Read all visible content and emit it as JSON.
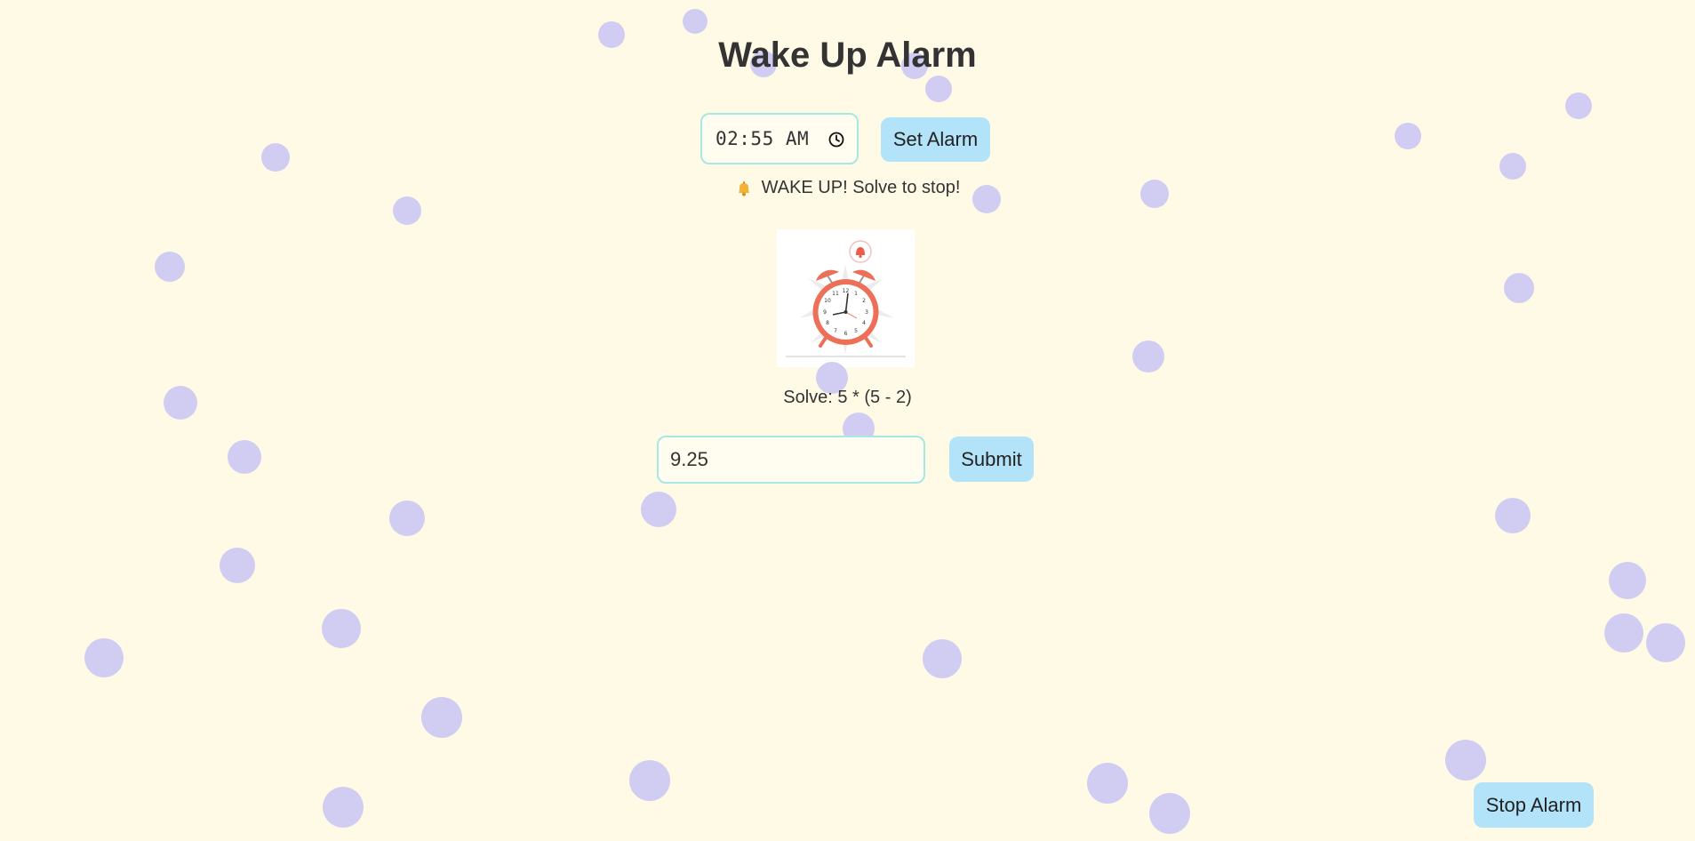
{
  "page": {
    "title": "Wake Up Alarm",
    "background_color": "#fffae6",
    "bubble_color": "#d1cdf2",
    "accent_color": "#b2e3f8",
    "input_border_color": "#a7e8e4"
  },
  "alarm": {
    "time_value": "02:55 AM",
    "time_icon": "clock-icon",
    "set_button_label": "Set Alarm"
  },
  "status": {
    "icon": "bell-icon",
    "text": "WAKE UP! Solve to stop!"
  },
  "illustration": {
    "icon": "alarm-clock-illustration"
  },
  "puzzle": {
    "problem_text": "Solve: 5 * (5 - 2)",
    "answer_value": "9.25",
    "submit_label": "Submit"
  },
  "controls": {
    "stop_label": "Stop Alarm"
  }
}
